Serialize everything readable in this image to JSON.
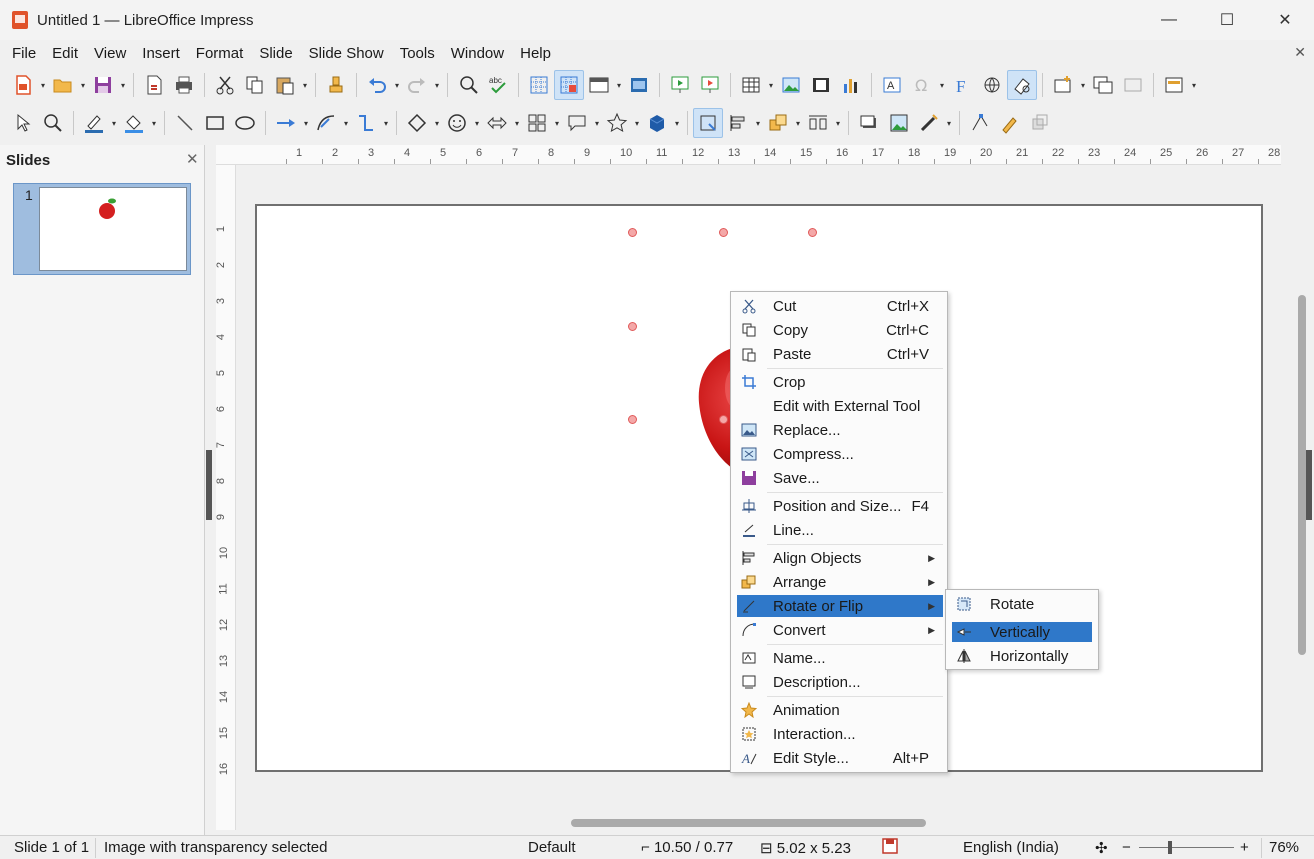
{
  "window": {
    "title": "Untitled 1 — LibreOffice Impress",
    "controls": [
      "—",
      "☐",
      "✕"
    ]
  },
  "menu": [
    "File",
    "Edit",
    "View",
    "Insert",
    "Format",
    "Slide",
    "Slide Show",
    "Tools",
    "Window",
    "Help"
  ],
  "menubar_close": "✕",
  "slides_pane": {
    "title": "Slides",
    "close": "✕",
    "slide_number": "1"
  },
  "ruler": {
    "horizontal": [
      "1",
      "2",
      "3",
      "4",
      "5",
      "6",
      "7",
      "8",
      "9",
      "10",
      "11",
      "12",
      "13",
      "14",
      "15",
      "16",
      "17",
      "18",
      "19",
      "20",
      "21",
      "22",
      "23",
      "24",
      "25",
      "26",
      "27",
      "28"
    ],
    "vertical": [
      "1",
      "2",
      "3",
      "4",
      "5",
      "6",
      "7",
      "8",
      "9",
      "10",
      "11",
      "12",
      "13",
      "14",
      "15",
      "16"
    ]
  },
  "context_menu": {
    "items": [
      {
        "label": "Cut",
        "shortcut": "Ctrl+X",
        "icon": "cut-icon"
      },
      {
        "label": "Copy",
        "shortcut": "Ctrl+C",
        "icon": "copy-icon"
      },
      {
        "label": "Paste",
        "shortcut": "Ctrl+V",
        "icon": "paste-icon"
      },
      {
        "label": "Crop",
        "shortcut": "",
        "icon": "crop-icon"
      },
      {
        "label": "Edit with External Tool",
        "shortcut": "",
        "icon": ""
      },
      {
        "label": "Replace...",
        "shortcut": "",
        "icon": "replace-icon"
      },
      {
        "label": "Compress...",
        "shortcut": "",
        "icon": "compress-icon"
      },
      {
        "label": "Save...",
        "shortcut": "",
        "icon": "save-icon"
      },
      {
        "label": "Position and Size...",
        "shortcut": "F4",
        "icon": "position-size-icon"
      },
      {
        "label": "Line...",
        "shortcut": "",
        "icon": "line-icon"
      },
      {
        "label": "Align Objects",
        "shortcut": "",
        "icon": "align-icon",
        "submenu": true
      },
      {
        "label": "Arrange",
        "shortcut": "",
        "icon": "arrange-icon",
        "submenu": true
      },
      {
        "label": "Rotate or Flip",
        "shortcut": "",
        "icon": "rotate-flip-icon",
        "submenu": true,
        "highlighted": true
      },
      {
        "label": "Convert",
        "shortcut": "",
        "icon": "convert-icon",
        "submenu": true
      },
      {
        "label": "Name...",
        "shortcut": "",
        "icon": "name-icon"
      },
      {
        "label": "Description...",
        "shortcut": "",
        "icon": "description-icon"
      },
      {
        "label": "Animation",
        "shortcut": "",
        "icon": "animation-icon"
      },
      {
        "label": "Interaction...",
        "shortcut": "",
        "icon": "interaction-icon"
      },
      {
        "label": "Edit Style...",
        "shortcut": "Alt+P",
        "icon": "edit-style-icon"
      }
    ]
  },
  "submenu": {
    "items": [
      {
        "label": "Rotate",
        "icon": "rotate-icon"
      },
      {
        "label": "Vertically",
        "icon": "flip-vertical-icon",
        "highlighted": true
      },
      {
        "label": "Horizontally",
        "icon": "flip-horizontal-icon"
      }
    ]
  },
  "statusbar": {
    "slide": "Slide 1 of 1",
    "selection": "Image with transparency selected",
    "layout": "Default",
    "position": "10.50 / 0.77",
    "size": "5.02 x 5.23",
    "language": "English (India)",
    "zoom_minus": "−",
    "zoom_plus": "+",
    "zoom": "76%"
  },
  "colors": {
    "highlight": "#2f78c9",
    "accent": "#e0522a"
  }
}
